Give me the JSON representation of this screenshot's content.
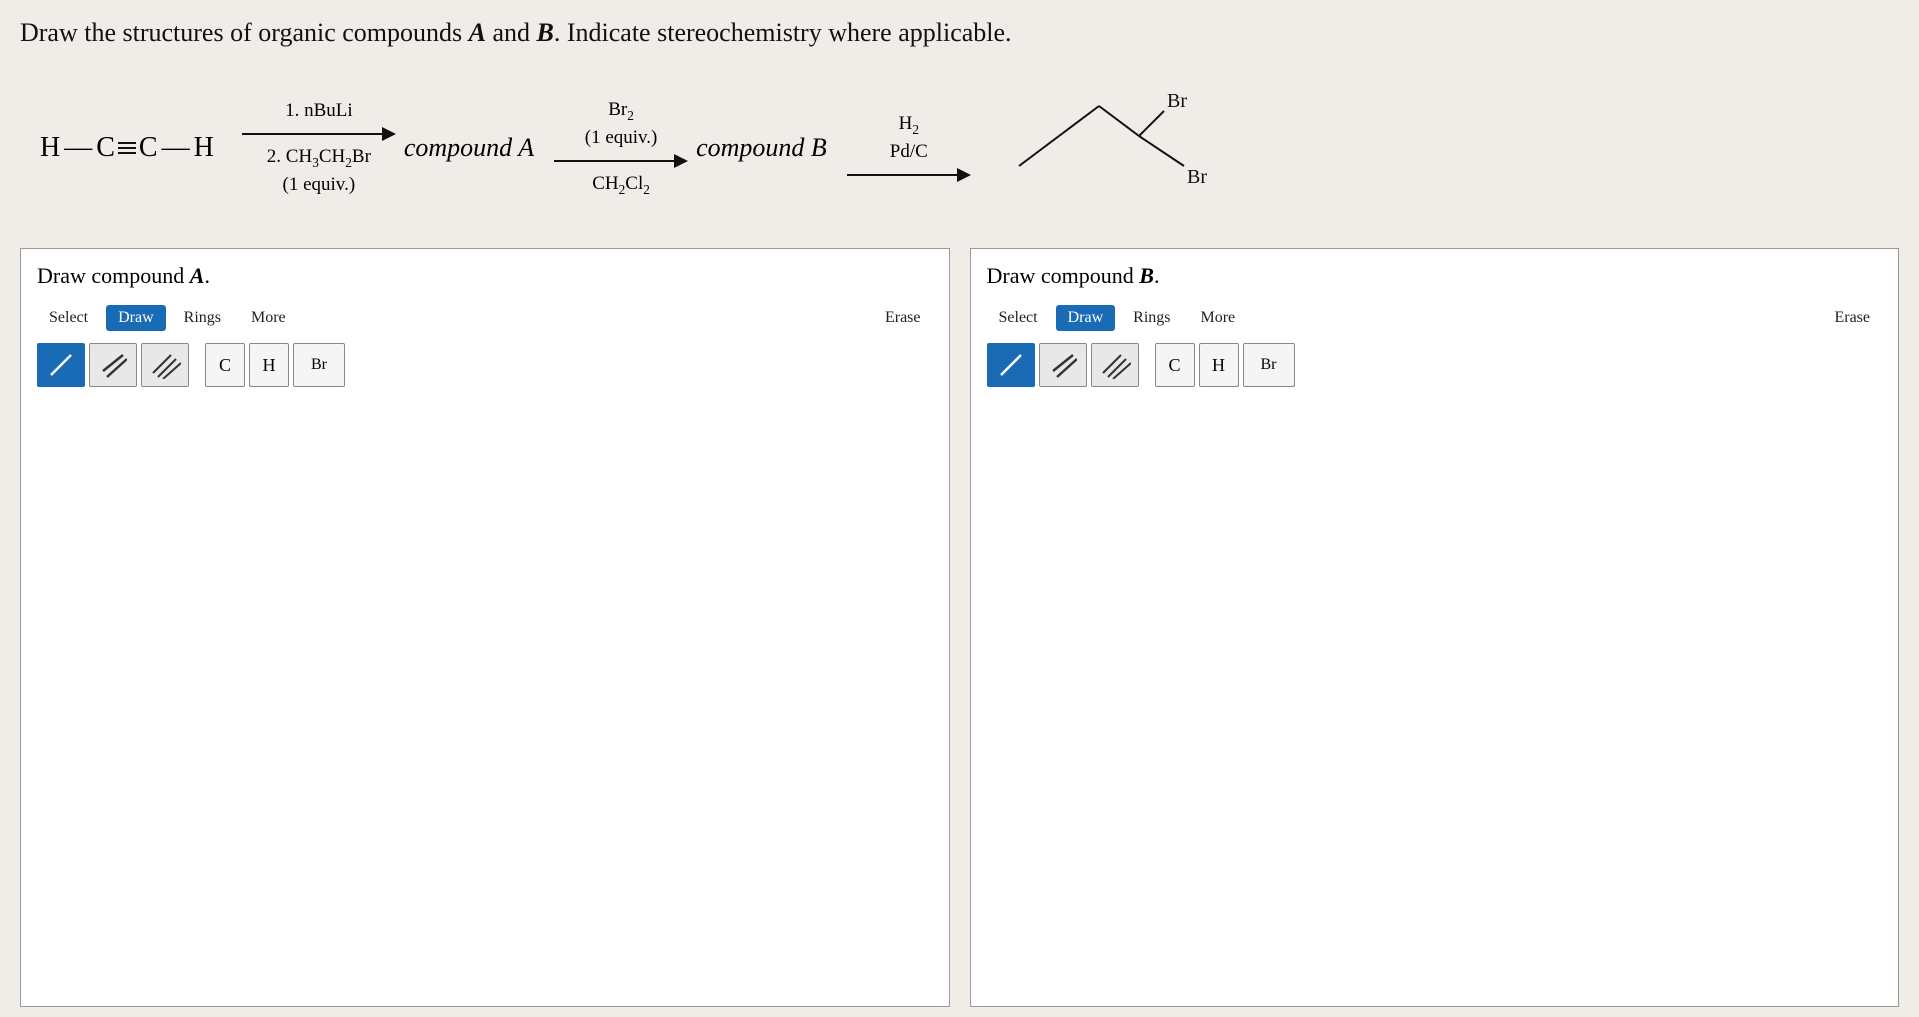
{
  "question": {
    "text": "Draw the structures of organic compounds ",
    "compound_a_label": "A",
    "compound_b_label": "B",
    "text2": " and ",
    "text3": ". Indicate stereochemistry where applicable."
  },
  "reaction": {
    "starting_material": "H—C≡C—H",
    "step1": {
      "reagent1": "1. nBuLi",
      "reagent2": "2. CH₃CH₂Br",
      "reagent3": "(1 equiv.)",
      "arrow_width": 160
    },
    "compound_a": "compound A",
    "step2": {
      "reagent1": "Br₂",
      "reagent2": "(1 equiv.)",
      "reagent3": "CH₂Cl₂"
    },
    "compound_b": "compound B",
    "step3": {
      "reagent1": "H₂",
      "reagent2": "Pd/C"
    },
    "product_label": "Br_Br_product"
  },
  "panels": {
    "left": {
      "title": "Draw compound ",
      "title_letter": "A",
      "title_period": ".",
      "toolbar": {
        "select": "Select",
        "draw": "Draw",
        "rings": "Rings",
        "more": "More",
        "erase": "Erase"
      },
      "bond_tools": {
        "single": "single-bond",
        "double": "double-bond",
        "triple": "triple-bond"
      },
      "atom_tools": {
        "carbon": "C",
        "hydrogen": "H",
        "bromine": "Br"
      }
    },
    "right": {
      "title": "Draw compound ",
      "title_letter": "B",
      "title_period": ".",
      "toolbar": {
        "select": "Select",
        "draw": "Draw",
        "rings": "Rings",
        "more": "More",
        "erase": "Erase"
      },
      "bond_tools": {
        "single": "single-bond",
        "double": "double-bond",
        "triple": "triple-bond"
      },
      "atom_tools": {
        "carbon": "C",
        "hydrogen": "H",
        "bromine": "Br"
      }
    }
  },
  "colors": {
    "active_btn": "#1a6bb5",
    "border": "#888",
    "background": "#f0ece8",
    "panel_bg": "#ffffff"
  }
}
